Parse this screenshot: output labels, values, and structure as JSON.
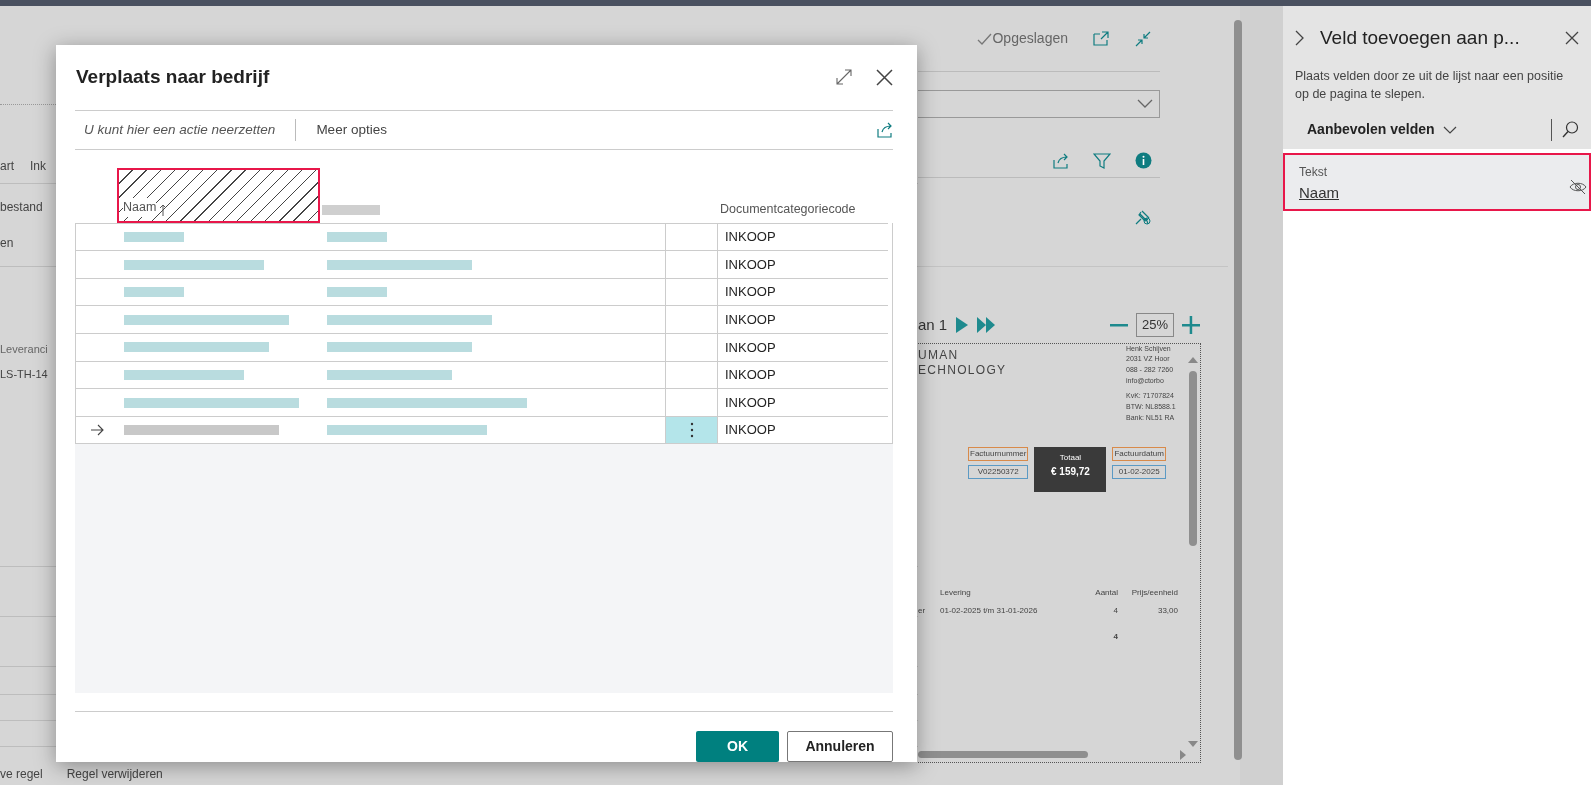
{
  "background_page": {
    "tabs_partial": [
      "art",
      "Ink"
    ],
    "menu_partial": [
      "bestand",
      "en"
    ],
    "field_label": "Leveranci",
    "field_value": "LS-TH-14",
    "bottom_actions": [
      "ve regel",
      "Regel verwijderen"
    ],
    "saved_status": "Opgeslagen",
    "preview": {
      "page_text": "an 1",
      "zoom": "25%",
      "document": {
        "company_lines": [
          "UMAN",
          "ECHNOLOGY"
        ],
        "address_lines": [
          "Henk Schijven",
          "2031 VZ Hoor",
          "088 - 282 7260",
          "info@ctorbo"
        ],
        "registration_lines": [
          "KvK: 71707824",
          "BTW: NL8588.1",
          "Bank: NL51 RA"
        ],
        "boxes": [
          {
            "kind": "outlined",
            "label": "Factuurnummer",
            "value": "V02250372"
          },
          {
            "kind": "total",
            "label": "Totaal",
            "value": "€ 159,72"
          },
          {
            "kind": "outlined",
            "label": "Factuurdatum",
            "value": "01-02-2025"
          }
        ],
        "line_columns": [
          "Levering",
          "Aantal",
          "Prijs/eenheid"
        ],
        "lines": [
          {
            "cells": [
              "er",
              "01-02-2025 t/m 31-01-2026",
              "4",
              "33,00"
            ]
          }
        ],
        "total_quantity": "4"
      }
    }
  },
  "dialog": {
    "title": "Verplaats naar bedrijf",
    "action_hint": "U kunt hier een actie neerzetten",
    "more_options": "Meer opties",
    "columns": [
      {
        "label": "Naam",
        "sorted_ascending": true,
        "drop_target": true
      },
      {
        "label": "Documentcategoriecode",
        "sorted_ascending": false,
        "drop_target": false
      }
    ],
    "rows": [
      {
        "code": "INKOOP",
        "current": false,
        "menu_selected": false
      },
      {
        "code": "INKOOP",
        "current": false,
        "menu_selected": false
      },
      {
        "code": "INKOOP",
        "current": false,
        "menu_selected": false
      },
      {
        "code": "INKOOP",
        "current": false,
        "menu_selected": false
      },
      {
        "code": "INKOOP",
        "current": false,
        "menu_selected": false
      },
      {
        "code": "INKOOP",
        "current": false,
        "menu_selected": false
      },
      {
        "code": "INKOOP",
        "current": false,
        "menu_selected": false
      },
      {
        "code": "INKOOP",
        "current": true,
        "menu_selected": true
      }
    ],
    "buttons": [
      {
        "label": "OK",
        "primary": true
      },
      {
        "label": "Annuleren",
        "primary": false
      }
    ]
  },
  "side_pane": {
    "title": "Veld toevoegen aan p...",
    "description": "Plaats velden door ze uit de lijst naar een positie op de pagina te slepen.",
    "filter": "Aanbevolen velden",
    "fields": [
      {
        "type": "Tekst",
        "name": "Naam",
        "highlighted": true
      }
    ]
  }
}
